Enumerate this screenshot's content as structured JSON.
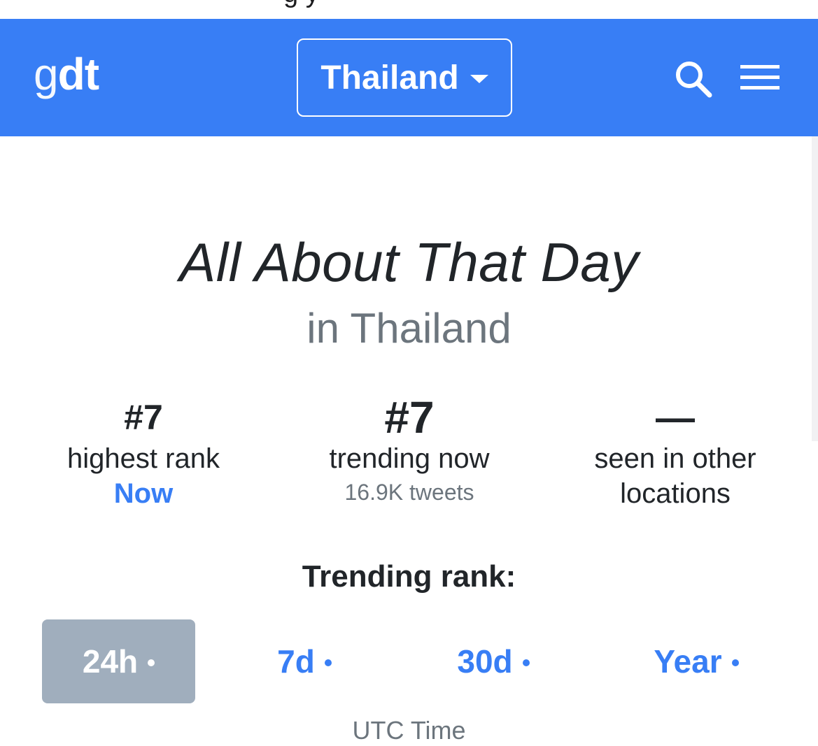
{
  "top_cutoff_text": "g  y",
  "navbar": {
    "brand_light": "g",
    "brand_bold": "dt",
    "location_label": "Thailand",
    "search_icon": "search-icon",
    "menu_icon": "hamburger-menu-icon",
    "background_color": "#387ef5"
  },
  "trend": {
    "title": "All About That Day",
    "subtitle": "in Thailand"
  },
  "stats": {
    "highest_rank": {
      "value": "#7",
      "label": "highest rank",
      "sub": "Now"
    },
    "trending_now": {
      "value": "#7",
      "label": "trending now",
      "sub": "16.9K tweets"
    },
    "other_locations": {
      "value": "—",
      "label_line1": "seen in other",
      "label_line2": "locations"
    }
  },
  "rank_section": {
    "heading": "Trending rank:",
    "tabs": [
      {
        "label": "24h",
        "active": true
      },
      {
        "label": "7d",
        "active": false
      },
      {
        "label": "30d",
        "active": false
      },
      {
        "label": "Year",
        "active": false
      }
    ],
    "timezone_note": "UTC Time"
  },
  "colors": {
    "accent": "#387ef5",
    "muted": "#6c757d",
    "active_tab": "#a0aebd"
  }
}
